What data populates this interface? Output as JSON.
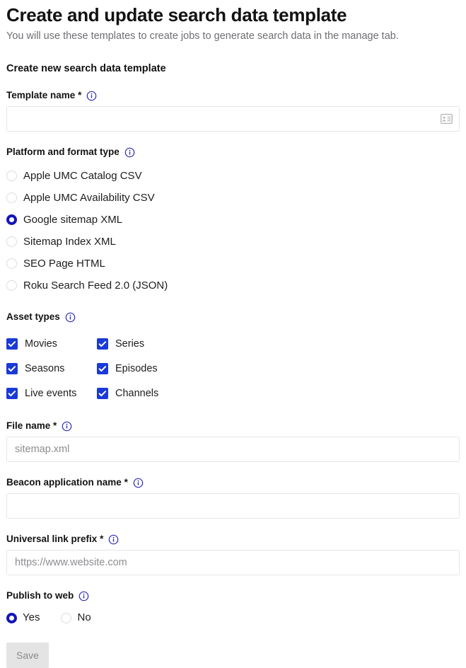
{
  "header": {
    "title": "Create and update search data template",
    "subtitle": "You will use these templates to create jobs to generate search data in the manage tab."
  },
  "section": {
    "title": "Create new search data template"
  },
  "fields": {
    "template_name": {
      "label": "Template name",
      "required_mark": "*",
      "value": "",
      "placeholder": "",
      "info_icon": "info-circle-icon",
      "addon_icon": "address-card-icon"
    },
    "platform_format_type": {
      "label": "Platform and format type",
      "info_icon": "info-circle-icon",
      "options": [
        {
          "label": "Apple UMC Catalog CSV",
          "selected": false
        },
        {
          "label": "Apple UMC Availability CSV",
          "selected": false
        },
        {
          "label": "Google sitemap XML",
          "selected": true
        },
        {
          "label": "Sitemap Index XML",
          "selected": false
        },
        {
          "label": "SEO Page HTML",
          "selected": false
        },
        {
          "label": "Roku Search Feed 2.0 (JSON)",
          "selected": false
        }
      ]
    },
    "asset_types": {
      "label": "Asset types",
      "info_icon": "info-circle-icon",
      "options": [
        {
          "label": "Movies",
          "checked": true
        },
        {
          "label": "Series",
          "checked": true
        },
        {
          "label": "Seasons",
          "checked": true
        },
        {
          "label": "Episodes",
          "checked": true
        },
        {
          "label": "Live events",
          "checked": true
        },
        {
          "label": "Channels",
          "checked": true
        }
      ]
    },
    "file_name": {
      "label": "File name",
      "required_mark": "*",
      "value": "",
      "placeholder": "sitemap.xml",
      "info_icon": "info-circle-icon"
    },
    "beacon_application_name": {
      "label": "Beacon application name",
      "required_mark": "*",
      "value": "",
      "placeholder": "",
      "info_icon": "info-circle-icon"
    },
    "universal_link_prefix": {
      "label": "Universal link prefix",
      "required_mark": "*",
      "value": "",
      "placeholder": "https://www.website.com",
      "info_icon": "info-circle-icon"
    },
    "publish_to_web": {
      "label": "Publish to web",
      "info_icon": "info-circle-icon",
      "options": [
        {
          "label": "Yes",
          "selected": true
        },
        {
          "label": "No",
          "selected": false
        }
      ]
    }
  },
  "actions": {
    "save_label": "Save",
    "save_disabled": true
  },
  "colors": {
    "accent_blue": "#1a3ad6",
    "info_icon_blue": "#2d2db5",
    "radio_selected": "#1414b8",
    "text_primary": "#1d1d1f",
    "text_muted": "#6e6e73",
    "placeholder": "#8d8d92",
    "input_border": "#e6e6e6",
    "disabled_button_bg": "#e4e4e4",
    "disabled_button_text": "#8a8a8f"
  }
}
